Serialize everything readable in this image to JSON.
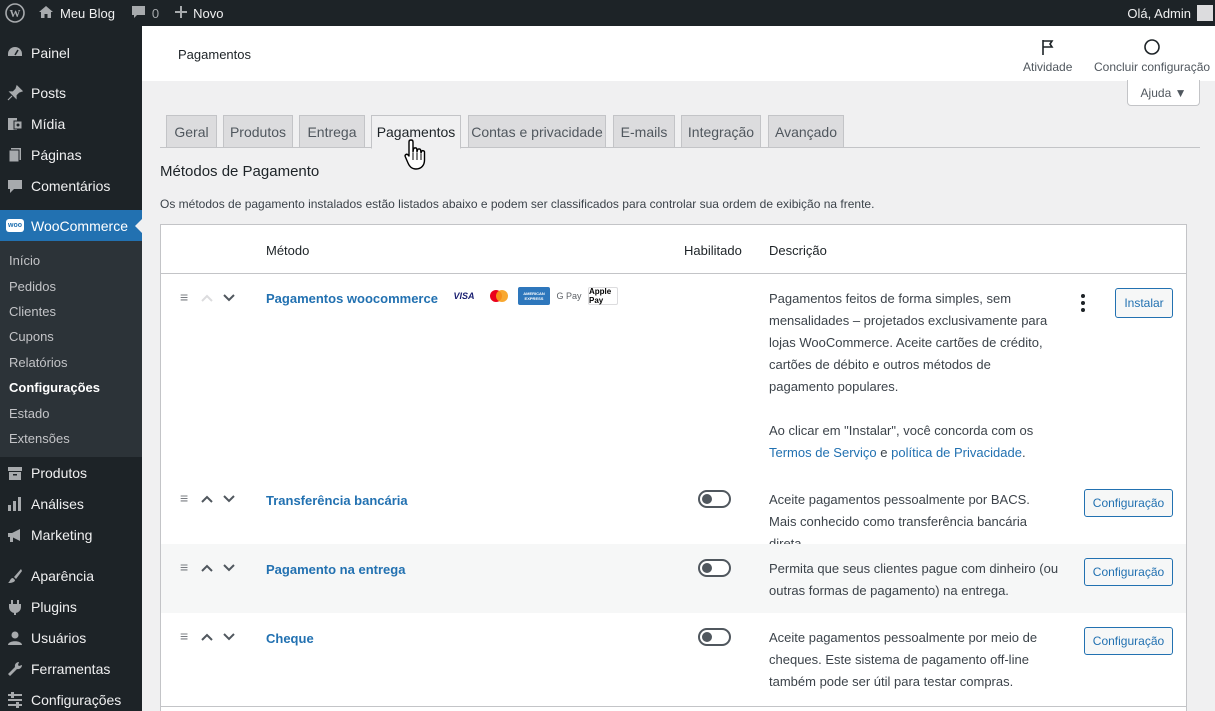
{
  "admin_bar": {
    "site_name": "Meu Blog",
    "comments_count": "0",
    "new_label": "Novo",
    "greeting": "Olá, Admin"
  },
  "sidebar": {
    "items_top": [
      {
        "label": "Painel",
        "icon": "dashboard-icon"
      },
      {
        "label": "Posts",
        "icon": "pin-icon"
      },
      {
        "label": "Mídia",
        "icon": "media-icon"
      },
      {
        "label": "Páginas",
        "icon": "pages-icon"
      },
      {
        "label": "Comentários",
        "icon": "comments-icon"
      }
    ],
    "woocommerce": {
      "label": "WooCommerce",
      "badge": "woo"
    },
    "submenu": [
      {
        "label": "Início"
      },
      {
        "label": "Pedidos"
      },
      {
        "label": "Clientes"
      },
      {
        "label": "Cupons"
      },
      {
        "label": "Relatórios"
      },
      {
        "label": "Configurações",
        "active": true
      },
      {
        "label": "Estado"
      },
      {
        "label": "Extensões"
      }
    ],
    "items_bottom": [
      {
        "label": "Produtos",
        "icon": "archive-icon"
      },
      {
        "label": "Análises",
        "icon": "chart-icon"
      },
      {
        "label": "Marketing",
        "icon": "megaphone-icon"
      },
      {
        "label": "Aparência",
        "icon": "brush-icon"
      },
      {
        "label": "Plugins",
        "icon": "plugin-icon"
      },
      {
        "label": "Usuários",
        "icon": "users-icon"
      },
      {
        "label": "Ferramentas",
        "icon": "wrench-icon"
      },
      {
        "label": "Configurações",
        "icon": "settings-icon"
      }
    ]
  },
  "header": {
    "page_title": "Pagamentos",
    "activity_label": "Atividade",
    "finish_setup_label": "Concluir configuração",
    "help_label": "Ajuda ▼"
  },
  "tabs": [
    {
      "label": "Geral"
    },
    {
      "label": "Produtos"
    },
    {
      "label": "Entrega"
    },
    {
      "label": "Pagamentos",
      "active": true
    },
    {
      "label": "Contas e privacidade"
    },
    {
      "label": "E-mails"
    },
    {
      "label": "Integração"
    },
    {
      "label": "Avançado"
    }
  ],
  "section": {
    "title": "Métodos de Pagamento",
    "description": "Os métodos de pagamento instalados estão listados abaixo e podem ser classificados para controlar sua ordem de exibição na frente."
  },
  "table": {
    "headers": {
      "method": "Método",
      "enabled": "Habilitado",
      "description": "Descrição"
    },
    "rows": [
      {
        "name": "Pagamentos woocommerce",
        "description_p1": "Pagamentos feitos de forma simples, sem mensalidades – projetados exclusivamente para lojas WooCommerce. Aceite cartões de crédito, cartões de débito e outros métodos de pagamento populares.",
        "description_p2_prefix": "Ao clicar em \"Instalar\", você concorda com os",
        "terms_link": "Termos de Serviço",
        "and_text": "e",
        "privacy_link": "política de Privacidade",
        "button": "Instalar",
        "logos": [
          "VISA",
          "mastercard",
          "AMERICAN EXPRESS",
          "G Pay",
          "Apple Pay"
        ]
      },
      {
        "name": "Transferência bancária",
        "description": "Aceite pagamentos pessoalmente por BACS. Mais conhecido como transferência bancária direta.",
        "enabled": false,
        "button": "Configuração"
      },
      {
        "name": "Pagamento na entrega",
        "description": "Permita que seus clientes pague com dinheiro (ou outras formas de pagamento) na entrega.",
        "enabled": false,
        "button": "Configuração"
      },
      {
        "name": "Cheque",
        "description": "Aceite pagamentos pessoalmente por meio de cheques. Este sistema de pagamento off-line também pode ser útil para testar compras.",
        "enabled": false,
        "button": "Configuração"
      }
    ]
  },
  "colors": {
    "accent": "#2271b1",
    "sidebar_bg": "#1d2327",
    "page_bg": "#f0f0f1"
  }
}
